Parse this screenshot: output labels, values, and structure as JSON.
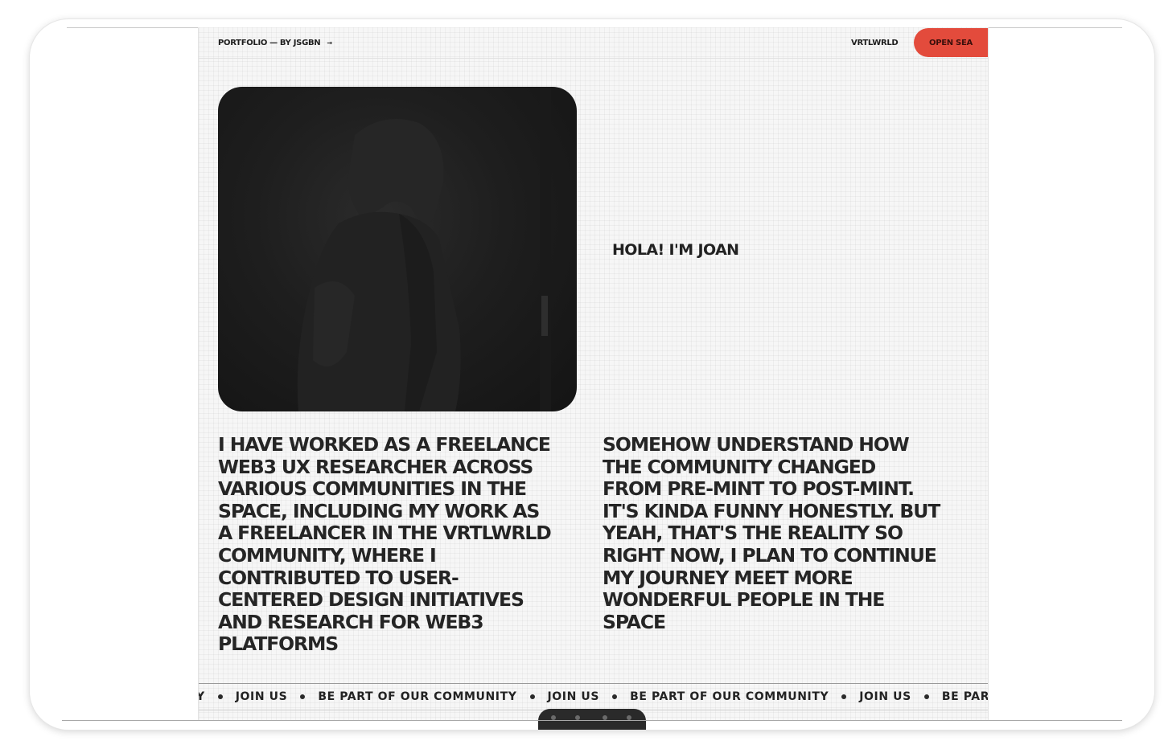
{
  "header": {
    "brand_title": "PORTFOLIO",
    "brand_sep": "—",
    "brand_author": "BY JSGBN",
    "brand_arrow": "→",
    "nav_link": "VRTLWRLD",
    "cta_label": "OPEN SEA"
  },
  "hero": {
    "greeting": "HOLA! I'M JOAN"
  },
  "bio": {
    "left": "I HAVE WORKED AS A FREELANCE\nWEB3 UX RESEARCHER ACROSS\nVARIOUS COMMUNITIES IN THE\nSPACE, INCLUDING MY WORK AS\nA FREELANCER IN THE VRTLWRLD\nCOMMUNITY, WHERE I\nCONTRIBUTED TO USER-\nCENTERED DESIGN INITIATIVES\nAND RESEARCH FOR WEB3\nPLATFORMS",
    "right": "SOMEHOW UNDERSTAND HOW\nTHE COMMUNITY CHANGED\nFROM PRE-MINT TO POST-MINT.\nIT'S KINDA FUNNY HONESTLY. BUT\nYEAH, THAT'S THE REALITY SO\nRIGHT NOW, I PLAN TO CONTINUE\nMY JOURNEY MEET MORE\nWONDERFUL PEOPLE IN THE\nSPACE"
  },
  "marquee": {
    "items": [
      "Y",
      "JOIN US",
      "BE PART OF OUR COMMUNITY",
      "JOIN US",
      "BE PART OF OUR COMMUNITY",
      "JOIN US",
      "BE PART O"
    ]
  },
  "colors": {
    "accent": "#e34b3c",
    "text": "#222222",
    "page_bg": "#f6f6f6"
  }
}
